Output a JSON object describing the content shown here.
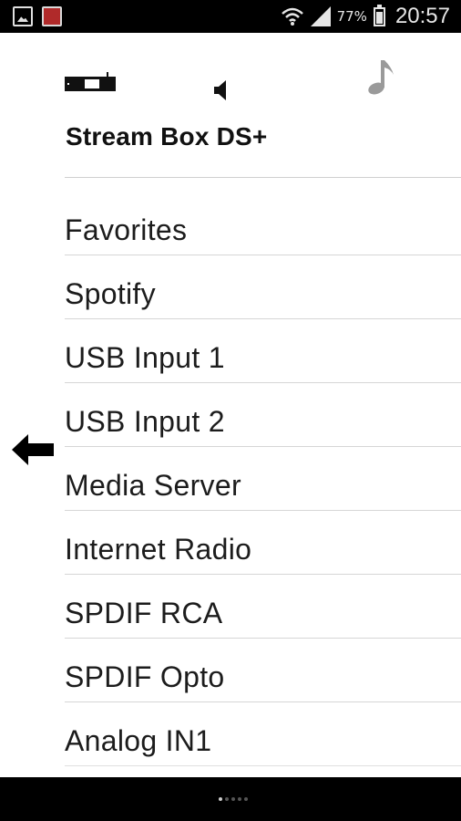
{
  "status_bar": {
    "battery_percent": "77%",
    "time": "20:57",
    "icons": [
      "gallery-icon",
      "app-icon",
      "wifi-icon",
      "signal-icon",
      "battery-icon"
    ]
  },
  "header": {
    "title": "Stream Box DS+",
    "icons": [
      "device-icon",
      "speaker-icon",
      "music-note-icon"
    ]
  },
  "sources": [
    {
      "label": "Favorites"
    },
    {
      "label": "Spotify"
    },
    {
      "label": "USB Input 1"
    },
    {
      "label": "USB Input 2"
    },
    {
      "label": "Media Server"
    },
    {
      "label": "Internet Radio"
    },
    {
      "label": "SPDIF RCA"
    },
    {
      "label": "SPDIF Opto"
    },
    {
      "label": "Analog IN1"
    }
  ],
  "navigation": {
    "back_icon": "back-arrow-icon",
    "page_count": 5,
    "active_page": 1
  },
  "colors": {
    "status_bar": "#000000",
    "background": "#ffffff",
    "text": "#1c1c1c",
    "divider": "#d6d6d6",
    "music_note": "#9a9a9a"
  }
}
